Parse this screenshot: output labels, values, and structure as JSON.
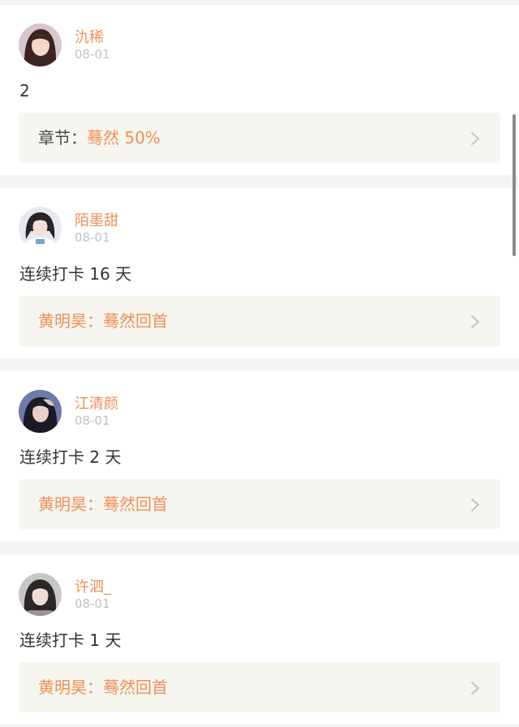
{
  "colors": {
    "accent": "#ef8f58",
    "chapter_bg": "#f6f5ef",
    "date_gray": "#c2c2c2",
    "text_dark": "#333333"
  },
  "posts": [
    {
      "user": "氿稀",
      "date": "08-01",
      "content": "2",
      "chapter_prefix": "章节：",
      "chapter_text": "蓦然 50%",
      "chevron_icon": "chevron-right-icon"
    },
    {
      "user": "陌墨甜",
      "date": "08-01",
      "content": "连续打卡 16 天",
      "chapter_prefix": "",
      "chapter_text": "黄明昊：蓦然回首",
      "chevron_icon": "chevron-right-icon"
    },
    {
      "user": "江清颜",
      "date": "08-01",
      "content": "连续打卡 2 天",
      "chapter_prefix": "",
      "chapter_text": "黄明昊：蓦然回首",
      "chevron_icon": "chevron-right-icon"
    },
    {
      "user": "许泗_",
      "date": "08-01",
      "content": "连续打卡 1 天",
      "chapter_prefix": "",
      "chapter_text": "黄明昊：蓦然回首",
      "chevron_icon": "chevron-right-icon"
    }
  ]
}
